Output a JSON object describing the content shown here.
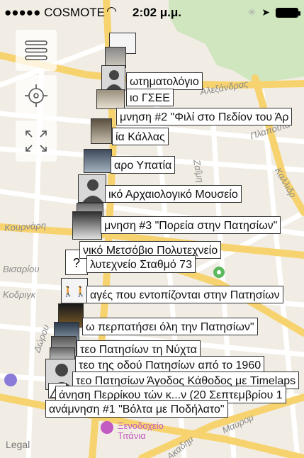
{
  "status_bar": {
    "carrier": "●●●●● COSMOTE",
    "time": "2:02 μ.μ."
  },
  "controls": {
    "menu_icon": "hamburger-icon",
    "locate_icon": "locate-crosshair-icon",
    "expand_icon": "expand-arrows-icon"
  },
  "map": {
    "streets": [
      "Αλεξάνδρας",
      "Πλαπούτα",
      "Καλλιδρ",
      "Κουρνάρη",
      "Βισαρίου",
      "Κοδριγκ",
      "Αγορά",
      "Δώρου",
      "Ζαΐμη",
      "Μαυρομ",
      "Ακαδημ"
    ],
    "hotel": {
      "line1": "Ξενοδοχείο",
      "line2": "Τιτάνια"
    },
    "legal": "Legal"
  },
  "labels": [
    "ωτηματολόγιο",
    "ιο ΓΣΕΕ",
    "μνηση #2 \"Φιλί στο Πεδίον του Άρ",
    "ία Κάλλας",
    "αρο Υπατία",
    "ικό Αρχαιολογικό Μουσείο",
    "μνηση #3 \"Πορεία στην Πατησίων\"",
    "νικό Μετσόβιο Πολυτεχνείο",
    "λυτεχνείο Σταθμό 73",
    "αγές που εντοπίζονται στην Πατησίων",
    "ω περπατήσει όλη την Πατησίων\"",
    "τεο Πατησίων τη Νύχτα",
    "τεο της οδού Πατησίων από το 1960",
    "τεο Πατησίων Άγοδος Κάθοδος με Timelaps",
    "άνηση Περρίκου τών κ...ν (20 Σεπτεμβρίου 1",
    "ανάμνηση #1 \"Βόλτα με Ποδήλατο\""
  ],
  "colors": {
    "park": "#cfe6bf",
    "street_yellow": "#f7d36f",
    "street_white": "#ffffff",
    "map_bg": "#f1ede4"
  }
}
